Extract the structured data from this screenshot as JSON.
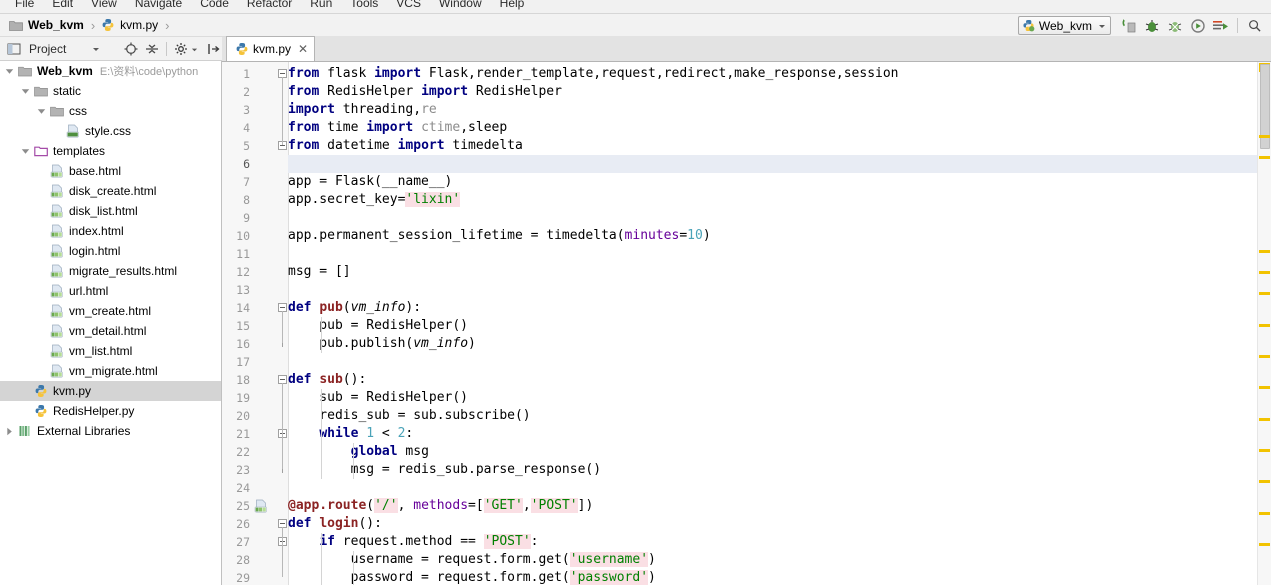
{
  "menu": {
    "items": [
      "File",
      "Edit",
      "View",
      "Navigate",
      "Code",
      "Refactor",
      "Run",
      "Tools",
      "VCS",
      "Window",
      "Help"
    ]
  },
  "breadcrumb": {
    "project_label": "Web_kvm",
    "project_icon": "folder-icon",
    "file_label": "kvm.py",
    "file_icon": "python-file-icon",
    "separator": "›"
  },
  "toolbar": {
    "run_config_label": "Web_kvm",
    "run_config_icon": "python-config-icon",
    "dropdown_icon": "chevron-down-icon",
    "buttons": [
      {
        "name": "run-button",
        "icon": "run-icon",
        "title": "Run"
      },
      {
        "name": "debug-button",
        "icon": "debug-icon",
        "title": "Debug"
      },
      {
        "name": "coverage-button",
        "icon": "coverage-icon",
        "title": "Run with Coverage"
      },
      {
        "name": "profile-button",
        "icon": "profile-icon",
        "title": "Profile"
      },
      {
        "name": "console-button",
        "icon": "console-icon",
        "title": "Python Console"
      }
    ],
    "search_icon": "search-icon"
  },
  "project_panel": {
    "icon": "project-window-icon",
    "title": "Project",
    "dropdown_icon": "chevron-down-icon",
    "buttons": [
      {
        "name": "locate-button",
        "icon": "target-icon"
      },
      {
        "name": "collapse-all-button",
        "icon": "collapse-all-icon"
      },
      {
        "name": "settings-button",
        "icon": "gear-icon"
      },
      {
        "name": "hide-button",
        "icon": "hide-panel-icon"
      }
    ]
  },
  "tabs": [
    {
      "label": "kvm.py",
      "icon": "python-file-icon",
      "close_icon": "close-icon",
      "active": true
    }
  ],
  "tree": [
    {
      "label": "Web_kvm",
      "path": "E:\\资料\\code\\python",
      "icon": "folder-icon",
      "indent": 0,
      "twist": "expanded",
      "bold": true,
      "selected": false
    },
    {
      "label": "static",
      "path": "",
      "icon": "folder-icon",
      "indent": 1,
      "twist": "expanded",
      "bold": false,
      "selected": false
    },
    {
      "label": "css",
      "path": "",
      "icon": "folder-icon",
      "indent": 2,
      "twist": "expanded",
      "bold": false,
      "selected": false
    },
    {
      "label": "style.css",
      "path": "",
      "icon": "css-file-icon",
      "indent": 3,
      "twist": "none",
      "bold": false,
      "selected": false
    },
    {
      "label": "templates",
      "path": "",
      "icon": "templates-folder-icon",
      "indent": 1,
      "twist": "expanded",
      "bold": false,
      "selected": false
    },
    {
      "label": "base.html",
      "path": "",
      "icon": "html-file-icon",
      "indent": 2,
      "twist": "none",
      "bold": false,
      "selected": false
    },
    {
      "label": "disk_create.html",
      "path": "",
      "icon": "html-file-icon",
      "indent": 2,
      "twist": "none",
      "bold": false,
      "selected": false
    },
    {
      "label": "disk_list.html",
      "path": "",
      "icon": "html-file-icon",
      "indent": 2,
      "twist": "none",
      "bold": false,
      "selected": false
    },
    {
      "label": "index.html",
      "path": "",
      "icon": "html-file-icon",
      "indent": 2,
      "twist": "none",
      "bold": false,
      "selected": false
    },
    {
      "label": "login.html",
      "path": "",
      "icon": "html-file-icon",
      "indent": 2,
      "twist": "none",
      "bold": false,
      "selected": false
    },
    {
      "label": "migrate_results.html",
      "path": "",
      "icon": "html-file-icon",
      "indent": 2,
      "twist": "none",
      "bold": false,
      "selected": false
    },
    {
      "label": "url.html",
      "path": "",
      "icon": "html-file-icon",
      "indent": 2,
      "twist": "none",
      "bold": false,
      "selected": false
    },
    {
      "label": "vm_create.html",
      "path": "",
      "icon": "html-file-icon",
      "indent": 2,
      "twist": "none",
      "bold": false,
      "selected": false
    },
    {
      "label": "vm_detail.html",
      "path": "",
      "icon": "html-file-icon",
      "indent": 2,
      "twist": "none",
      "bold": false,
      "selected": false
    },
    {
      "label": "vm_list.html",
      "path": "",
      "icon": "html-file-icon",
      "indent": 2,
      "twist": "none",
      "bold": false,
      "selected": false
    },
    {
      "label": "vm_migrate.html",
      "path": "",
      "icon": "html-file-icon",
      "indent": 2,
      "twist": "none",
      "bold": false,
      "selected": false
    },
    {
      "label": "kvm.py",
      "path": "",
      "icon": "python-file-icon",
      "indent": 1,
      "twist": "none",
      "bold": false,
      "selected": true
    },
    {
      "label": "RedisHelper.py",
      "path": "",
      "icon": "python-file-icon",
      "indent": 1,
      "twist": "none",
      "bold": false,
      "selected": false
    },
    {
      "label": "External Libraries",
      "path": "",
      "icon": "libraries-icon",
      "indent": 0,
      "twist": "collapsed",
      "bold": false,
      "selected": false
    }
  ],
  "editor": {
    "first_line": 1,
    "current_line": 6,
    "lines": [
      {
        "n": 1,
        "tokens": [
          {
            "t": "from ",
            "c": "kw"
          },
          {
            "t": "flask ",
            "c": "plain"
          },
          {
            "t": "import ",
            "c": "kw"
          },
          {
            "t": "Flask,render_template,request,redirect,make_response,session",
            "c": "plain"
          }
        ]
      },
      {
        "n": 2,
        "tokens": [
          {
            "t": "from ",
            "c": "kw"
          },
          {
            "t": "RedisHelper ",
            "c": "plain"
          },
          {
            "t": "import ",
            "c": "kw"
          },
          {
            "t": "RedisHelper",
            "c": "plain"
          }
        ]
      },
      {
        "n": 3,
        "tokens": [
          {
            "t": "import ",
            "c": "kw"
          },
          {
            "t": "threading,",
            "c": "plain"
          },
          {
            "t": "re",
            "c": "dim"
          }
        ]
      },
      {
        "n": 4,
        "tokens": [
          {
            "t": "from ",
            "c": "kw"
          },
          {
            "t": "time ",
            "c": "plain"
          },
          {
            "t": "import ",
            "c": "kw"
          },
          {
            "t": "ctime",
            "c": "dim"
          },
          {
            "t": ",sleep",
            "c": "plain"
          }
        ]
      },
      {
        "n": 5,
        "tokens": [
          {
            "t": "from ",
            "c": "kw"
          },
          {
            "t": "datetime ",
            "c": "plain"
          },
          {
            "t": "import ",
            "c": "kw"
          },
          {
            "t": "timedelta",
            "c": "plain"
          }
        ]
      },
      {
        "n": 6,
        "tokens": []
      },
      {
        "n": 7,
        "tokens": [
          {
            "t": "app = Flask(__name__)",
            "c": "plain"
          }
        ]
      },
      {
        "n": 8,
        "tokens": [
          {
            "t": "app.secret_key=",
            "c": "plain"
          },
          {
            "t": "'lixin'",
            "c": "str"
          }
        ]
      },
      {
        "n": 9,
        "tokens": []
      },
      {
        "n": 10,
        "tokens": [
          {
            "t": "app.permanent_session_lifetime = timedelta(",
            "c": "plain"
          },
          {
            "t": "minutes",
            "c": "param"
          },
          {
            "t": "=",
            "c": "plain"
          },
          {
            "t": "10",
            "c": "num2"
          },
          {
            "t": ")",
            "c": "plain"
          }
        ]
      },
      {
        "n": 11,
        "tokens": []
      },
      {
        "n": 12,
        "tokens": [
          {
            "t": "msg = []",
            "c": "plain"
          }
        ]
      },
      {
        "n": 13,
        "tokens": []
      },
      {
        "n": 14,
        "tokens": [
          {
            "t": "def ",
            "c": "kw"
          },
          {
            "t": "pub",
            "c": "fn"
          },
          {
            "t": "(",
            "c": "plain"
          },
          {
            "t": "vm_info",
            "c": "ital"
          },
          {
            "t": "):",
            "c": "plain"
          }
        ]
      },
      {
        "n": 15,
        "tokens": [
          {
            "t": "    pub = RedisHelper()",
            "c": "plain"
          }
        ]
      },
      {
        "n": 16,
        "tokens": [
          {
            "t": "    pub.publish(",
            "c": "plain"
          },
          {
            "t": "vm_info",
            "c": "ital"
          },
          {
            "t": ")",
            "c": "plain"
          }
        ]
      },
      {
        "n": 17,
        "tokens": []
      },
      {
        "n": 18,
        "tokens": [
          {
            "t": "def ",
            "c": "kw"
          },
          {
            "t": "sub",
            "c": "fn"
          },
          {
            "t": "():",
            "c": "plain"
          }
        ]
      },
      {
        "n": 19,
        "tokens": [
          {
            "t": "    sub = RedisHelper()",
            "c": "plain"
          }
        ]
      },
      {
        "n": 20,
        "tokens": [
          {
            "t": "    redis_sub = sub.subscribe()",
            "c": "plain"
          }
        ]
      },
      {
        "n": 21,
        "tokens": [
          {
            "t": "    ",
            "c": "plain"
          },
          {
            "t": "while ",
            "c": "kw"
          },
          {
            "t": "1",
            "c": "num2"
          },
          {
            "t": " < ",
            "c": "plain"
          },
          {
            "t": "2",
            "c": "num2"
          },
          {
            "t": ":",
            "c": "plain"
          }
        ]
      },
      {
        "n": 22,
        "tokens": [
          {
            "t": "        ",
            "c": "plain"
          },
          {
            "t": "global ",
            "c": "kw"
          },
          {
            "t": "msg",
            "c": "plain"
          }
        ]
      },
      {
        "n": 23,
        "tokens": [
          {
            "t": "        msg = redis_sub.parse_response()",
            "c": "plain"
          }
        ]
      },
      {
        "n": 24,
        "tokens": []
      },
      {
        "n": 25,
        "tokens": [
          {
            "t": "@app.route",
            "c": "deco"
          },
          {
            "t": "(",
            "c": "plain"
          },
          {
            "t": "'/'",
            "c": "str"
          },
          {
            "t": ", ",
            "c": "plain"
          },
          {
            "t": "methods",
            "c": "param"
          },
          {
            "t": "=[",
            "c": "plain"
          },
          {
            "t": "'GET'",
            "c": "str"
          },
          {
            "t": ",",
            "c": "plain"
          },
          {
            "t": "'POST'",
            "c": "str"
          },
          {
            "t": "])",
            "c": "plain"
          }
        ]
      },
      {
        "n": 26,
        "tokens": [
          {
            "t": "def ",
            "c": "kw"
          },
          {
            "t": "login",
            "c": "fn"
          },
          {
            "t": "():",
            "c": "plain"
          }
        ]
      },
      {
        "n": 27,
        "tokens": [
          {
            "t": "    ",
            "c": "plain"
          },
          {
            "t": "if ",
            "c": "kw"
          },
          {
            "t": "request.method == ",
            "c": "plain"
          },
          {
            "t": "'POST'",
            "c": "str"
          },
          {
            "t": ":",
            "c": "plain"
          }
        ]
      },
      {
        "n": 28,
        "tokens": [
          {
            "t": "        username = request.form.get(",
            "c": "plain"
          },
          {
            "t": "'username'",
            "c": "str"
          },
          {
            "t": ")",
            "c": "plain"
          }
        ]
      },
      {
        "n": 29,
        "tokens": [
          {
            "t": "        password = request.form.get(",
            "c": "plain"
          },
          {
            "t": "'password'",
            "c": "str"
          },
          {
            "t": ")",
            "c": "plain"
          }
        ]
      }
    ],
    "fold_markers": [
      {
        "line": 1,
        "type": "collapse"
      },
      {
        "line": 5,
        "type": "collapse"
      },
      {
        "line": 14,
        "type": "collapse"
      },
      {
        "line": 16,
        "type": "end"
      },
      {
        "line": 18,
        "type": "collapse"
      },
      {
        "line": 21,
        "type": "collapse"
      },
      {
        "line": 23,
        "type": "end"
      },
      {
        "line": 26,
        "type": "collapse"
      },
      {
        "line": 27,
        "type": "collapse"
      }
    ],
    "template_icon_line": 25
  },
  "marker_bar": {
    "warning_color": "#f2c300",
    "error_color": "#f0c000",
    "marks_at_percent": [
      14,
      18,
      36,
      40,
      44,
      50,
      56,
      62,
      68,
      74,
      80,
      86,
      92
    ]
  }
}
